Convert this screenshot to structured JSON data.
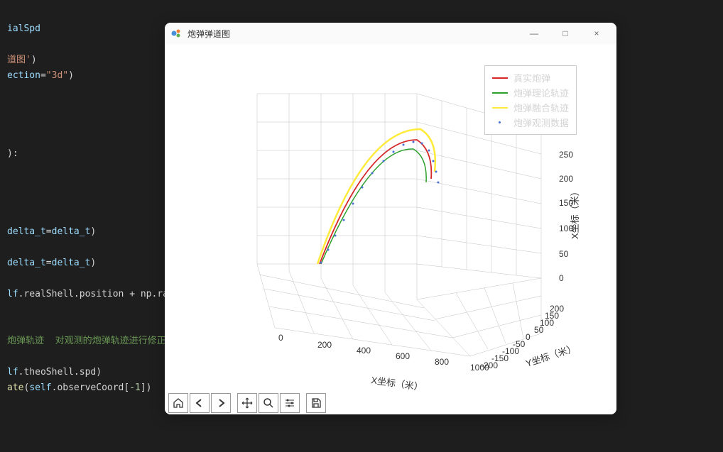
{
  "code": {
    "line1_var": "ialSpd",
    "line3_str": "道图'",
    "line3_close": ")",
    "line4_arg1": "ection",
    "line4_eq": "=",
    "line4_str": "\"3d\"",
    "line4_close": ")",
    "line8_close": "):",
    "line12_arg": "delta_t",
    "line12_eq": "=",
    "line12_var": "delta_t",
    "line12_close": ")",
    "line13_arg": "delta_t",
    "line13_eq": "=",
    "line13_var": "delta_t",
    "line13_close": ")",
    "line15_a": "lf",
    "line15_b": ".realShell.position ",
    "line15_c": "+",
    "line15_d": " np.ran",
    "line17_comment": "炮弹轨迹  对观测的炮弹轨迹进行修正",
    "line19_a": "lf",
    "line19_b": ".theoShell.spd)",
    "line20_fn": "ate",
    "line20_a": "(",
    "line20_b": "self",
    "line20_c": ".observeCoord[",
    "line20_d": "-1",
    "line20_e": "])"
  },
  "window": {
    "title": "炮弹弹道图",
    "minimize": "—",
    "maximize": "□",
    "close": "×"
  },
  "chart_data": {
    "type": "3d-line",
    "title": "",
    "legend": [
      {
        "name": "真实炮弹",
        "color": "#d62728",
        "style": "line"
      },
      {
        "name": "炮弹理论轨迹",
        "color": "#2ca02c",
        "style": "line"
      },
      {
        "name": "炮弹融合轨迹",
        "color": "#ffeb3b",
        "style": "line"
      },
      {
        "name": "炮弹观测数据",
        "color": "#4a6fd6",
        "style": "dots"
      }
    ],
    "axes": {
      "x": {
        "label": "X坐标（米）",
        "ticks": [
          0,
          200,
          400,
          600,
          800,
          1000
        ]
      },
      "y": {
        "label": "Y坐标（米）",
        "ticks": [
          -200,
          -150,
          -100,
          -50,
          0,
          50,
          100,
          150,
          200
        ]
      },
      "z": {
        "label": "X坐标（米）",
        "ticks": [
          0,
          50,
          100,
          150,
          200,
          250
        ]
      }
    },
    "series": [
      {
        "name": "真实炮弹",
        "approx_path": "arc from (0,0,0) rising to apex near (600,0,250) descending"
      },
      {
        "name": "炮弹理论轨迹",
        "approx_path": "similar arc slightly lower, green"
      },
      {
        "name": "炮弹融合轨迹",
        "approx_path": "similar arc slightly higher, yellow"
      },
      {
        "name": "炮弹观测数据",
        "approx_path": "scatter points along arc, blue"
      }
    ]
  },
  "toolbar": {
    "home": "home",
    "back": "back",
    "forward": "forward",
    "pan": "pan",
    "zoom": "zoom",
    "subplots": "subplots",
    "save": "save"
  }
}
